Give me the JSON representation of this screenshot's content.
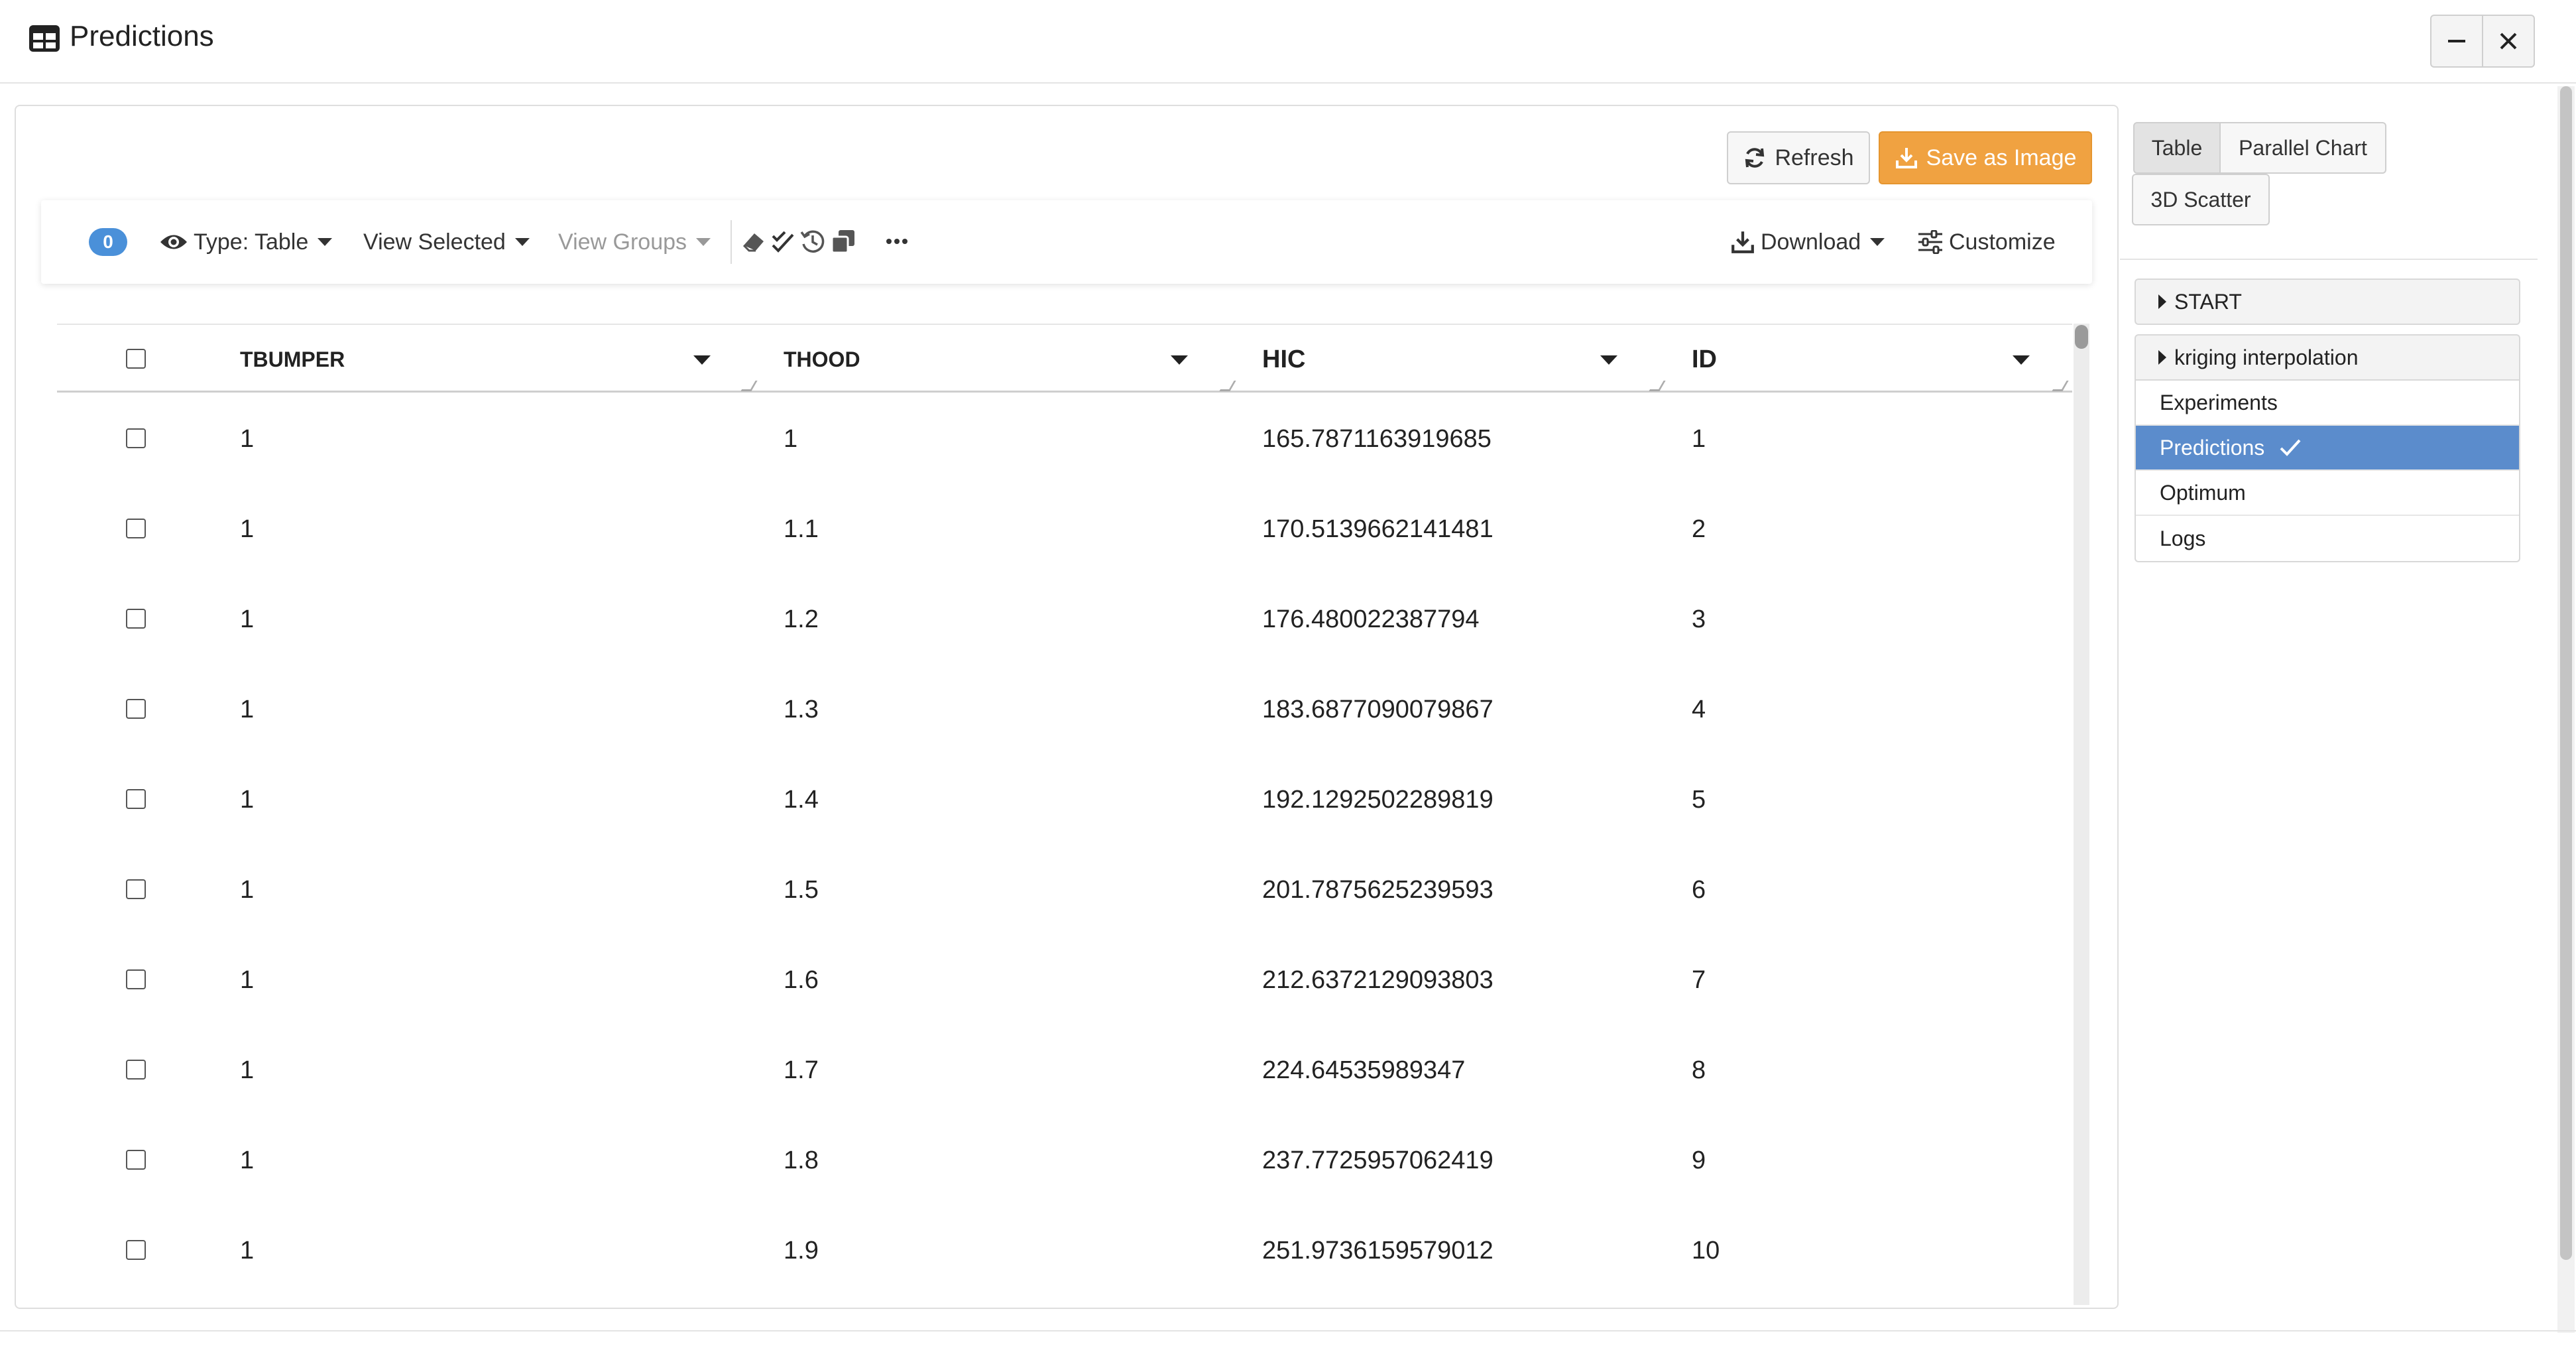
{
  "window": {
    "title": "Predictions"
  },
  "actions": {
    "refresh_label": "Refresh",
    "save_label": "Save as Image"
  },
  "toolbar": {
    "selected_count": "0",
    "type_label": "Type: Table",
    "view_selected_label": "View Selected",
    "view_groups_label": "View Groups",
    "download_label": "Download",
    "customize_label": "Customize"
  },
  "table": {
    "columns": [
      "TBUMPER",
      "THOOD",
      "HIC",
      "ID"
    ],
    "rows": [
      [
        "1",
        "1",
        "165.7871163919685",
        "1"
      ],
      [
        "1",
        "1.1",
        "170.5139662141481",
        "2"
      ],
      [
        "1",
        "1.2",
        "176.480022387794",
        "3"
      ],
      [
        "1",
        "1.3",
        "183.6877090079867",
        "4"
      ],
      [
        "1",
        "1.4",
        "192.1292502289819",
        "5"
      ],
      [
        "1",
        "1.5",
        "201.7875625239593",
        "6"
      ],
      [
        "1",
        "1.6",
        "212.6372129093803",
        "7"
      ],
      [
        "1",
        "1.7",
        "224.64535989347",
        "8"
      ],
      [
        "1",
        "1.8",
        "237.7725957062419",
        "9"
      ],
      [
        "1",
        "1.9",
        "251.9736159579012",
        "10"
      ]
    ]
  },
  "view_tabs": {
    "table": "Table",
    "parallel": "Parallel Chart",
    "scatter": "3D Scatter"
  },
  "nav": {
    "start": "START",
    "kriging": "kriging interpolation",
    "items": [
      "Experiments",
      "Predictions",
      "Optimum",
      "Logs"
    ],
    "active": "Predictions"
  },
  "colors": {
    "accent_orange": "#f0a241",
    "selected_blue": "#5b8ccc",
    "badge_blue": "#4a90d9"
  }
}
